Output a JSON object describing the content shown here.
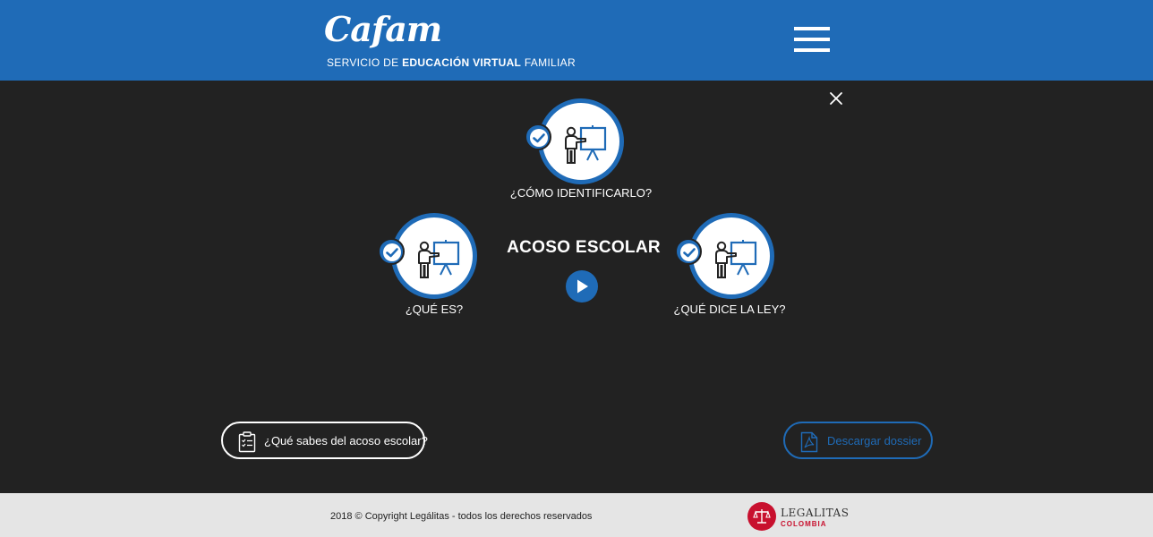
{
  "header": {
    "logo_text": "Cafam",
    "tagline_prefix": "SERVICIO DE",
    "tagline_bold": "EDUCACIÓN VIRTUAL",
    "tagline_suffix": "FAMILIAR",
    "menu_icon": "hamburger-menu-icon"
  },
  "main": {
    "close_icon": "close-icon",
    "title": "ACOSO ESCOLAR",
    "play_icon": "play-icon",
    "topics": [
      {
        "label": "¿QUÉ ES?",
        "icon": "presenter-board-icon",
        "completed": true
      },
      {
        "label": "¿CÓMO IDENTIFICARLO?",
        "icon": "presenter-board-icon",
        "completed": true
      },
      {
        "label": "¿QUÉ DICE LA LEY?",
        "icon": "presenter-board-icon",
        "completed": true
      }
    ],
    "quiz_button": {
      "label": "¿Qué sabes del acoso escolar?",
      "icon": "clipboard-checklist-icon"
    },
    "dossier_button": {
      "label": "Descargar dossier",
      "icon": "pdf-file-icon"
    }
  },
  "footer": {
    "copyright": "2018 © Copyright Legálitas - todos los derechos reservados",
    "partner_name": "LEGALITAS",
    "partner_country": "COLOMBIA",
    "partner_icon": "scales-of-justice-icon"
  },
  "colors": {
    "brand_blue": "#1f6bb7",
    "background_dark": "#222222",
    "footer_bg": "#e5e5e5",
    "legalitas_red": "#c8102e"
  }
}
